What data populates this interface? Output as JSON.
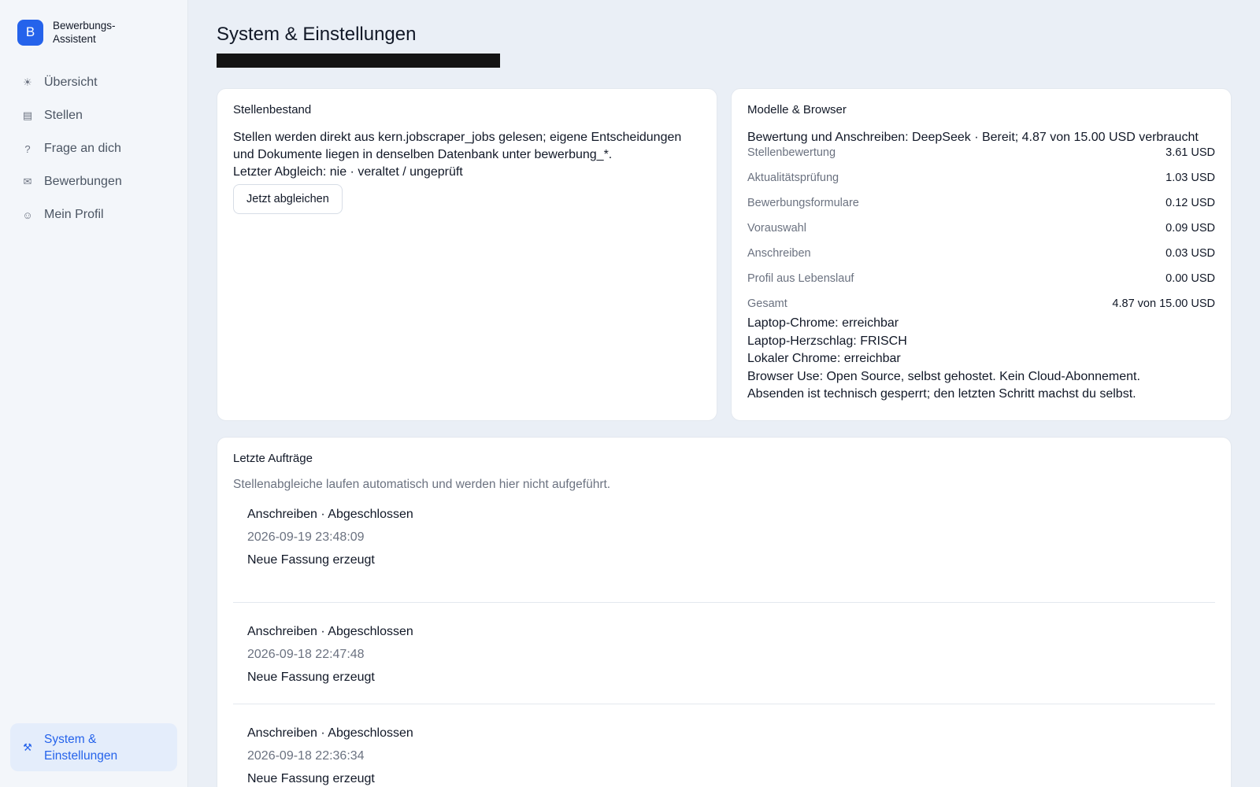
{
  "sidebar": {
    "brand_letter": "B",
    "brand_name": "Bewerbungs-Assistent",
    "items": [
      {
        "icon": "sun-icon",
        "glyph": "☀",
        "label": "Übersicht"
      },
      {
        "icon": "list-icon",
        "glyph": "▤",
        "label": "Stellen"
      },
      {
        "icon": "question-icon",
        "glyph": "?",
        "label": "Frage an dich"
      },
      {
        "icon": "mail-icon",
        "glyph": "✉",
        "label": "Bewerbungen"
      },
      {
        "icon": "smile-icon",
        "glyph": "☺",
        "label": "Mein Profil"
      }
    ],
    "active": {
      "icon": "tools-icon",
      "glyph": "⚒",
      "label": "System & Einstellungen"
    }
  },
  "page": {
    "title": "System & Einstellungen"
  },
  "stellenbestand": {
    "title": "Stellenbestand",
    "description": "Stellen werden direkt aus kern.jobscraper_jobs gelesen; eigene Entscheidungen und Dokumente liegen in denselben Datenbank unter bewerbung_*.",
    "last_sync": "Letzter Abgleich: nie · veraltet / ungeprüft",
    "sync_button": "Jetzt abgleichen"
  },
  "models": {
    "title": "Modelle & Browser",
    "model_label": "Bewertung und Anschreiben: DeepSeek",
    "model_status": " · Bereit; 4.87 von 15.00 USD verbraucht",
    "costs": [
      {
        "label": "Stellenbewertung",
        "value": "3.61 USD"
      },
      {
        "label": "Aktualitätsprüfung",
        "value": "1.03 USD"
      },
      {
        "label": "Bewerbungsformulare",
        "value": "0.12 USD"
      },
      {
        "label": "Vorauswahl",
        "value": "0.09 USD"
      },
      {
        "label": "Anschreiben",
        "value": "0.03 USD"
      },
      {
        "label": "Profil aus Lebenslauf",
        "value": "0.00 USD"
      }
    ],
    "total": {
      "label": "Gesamt",
      "value": "4.87 von 15.00 USD"
    },
    "status_lines": [
      "Laptop-Chrome: erreichbar",
      "Laptop-Herzschlag: FRISCH",
      "Lokaler Chrome: erreichbar",
      "Browser Use: Open Source, selbst gehostet. Kein Cloud-Abonnement.",
      "Absenden ist technisch gesperrt; den letzten Schritt machst du selbst."
    ]
  },
  "jobs": {
    "title": "Letzte Aufträge",
    "note": "Stellenabgleiche laufen automatisch und werden hier nicht aufgeführt.",
    "items": [
      {
        "type": "Anschreiben",
        "status": " · Abgeschlossen",
        "time": "2026-09-19 23:48:09",
        "result": "Neue Fassung erzeugt"
      },
      {
        "type": "Anschreiben",
        "status": " · Abgeschlossen",
        "time": "2026-09-18 22:47:48",
        "result": "Neue Fassung erzeugt"
      },
      {
        "type": "Anschreiben",
        "status": " · Abgeschlossen",
        "time": "2026-09-18 22:36:34",
        "result": "Neue Fassung erzeugt"
      }
    ]
  }
}
